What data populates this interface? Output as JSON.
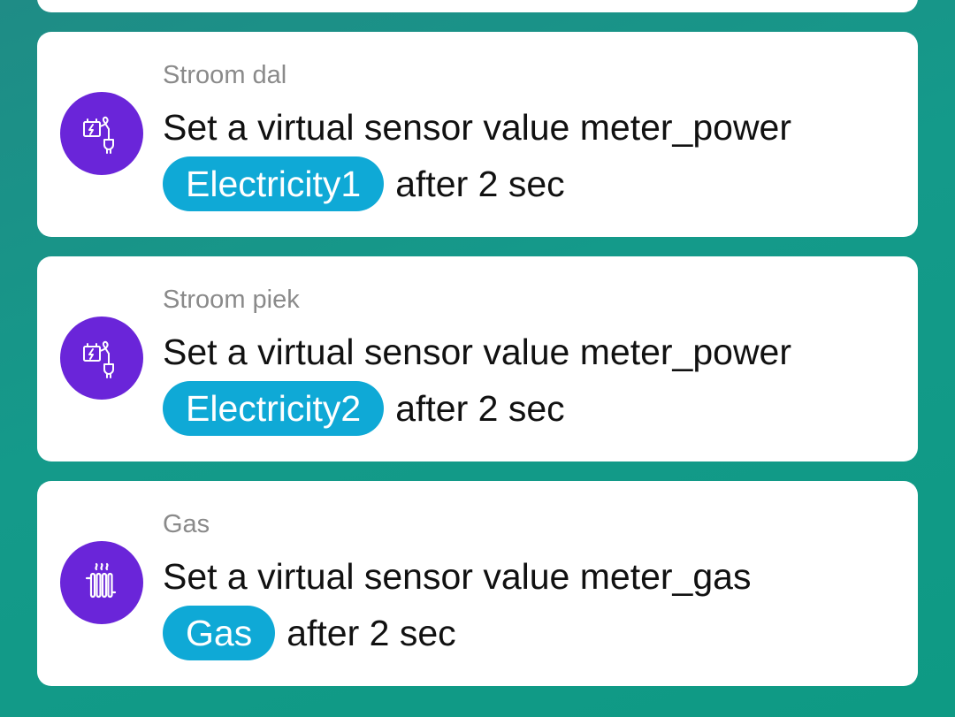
{
  "colors": {
    "background": "#149a8a",
    "card": "#ffffff",
    "icon_circle": "#6a25d9",
    "chip": "#0fa9d6",
    "subtitle": "#8a8a8a",
    "text": "#111111"
  },
  "actions": [
    {
      "subtitle": "Stroom dal",
      "title": "Set a virtual sensor value meter_power",
      "chip": "Electricity1",
      "suffix": "after 2 sec",
      "icon": "electricity-meter-icon"
    },
    {
      "subtitle": "Stroom piek",
      "title": "Set a virtual sensor value meter_power",
      "chip": "Electricity2",
      "suffix": "after 2 sec",
      "icon": "electricity-meter-icon"
    },
    {
      "subtitle": "Gas",
      "title": "Set a virtual sensor value meter_gas",
      "chip": "Gas",
      "suffix": "after 2 sec",
      "icon": "radiator-icon"
    }
  ]
}
